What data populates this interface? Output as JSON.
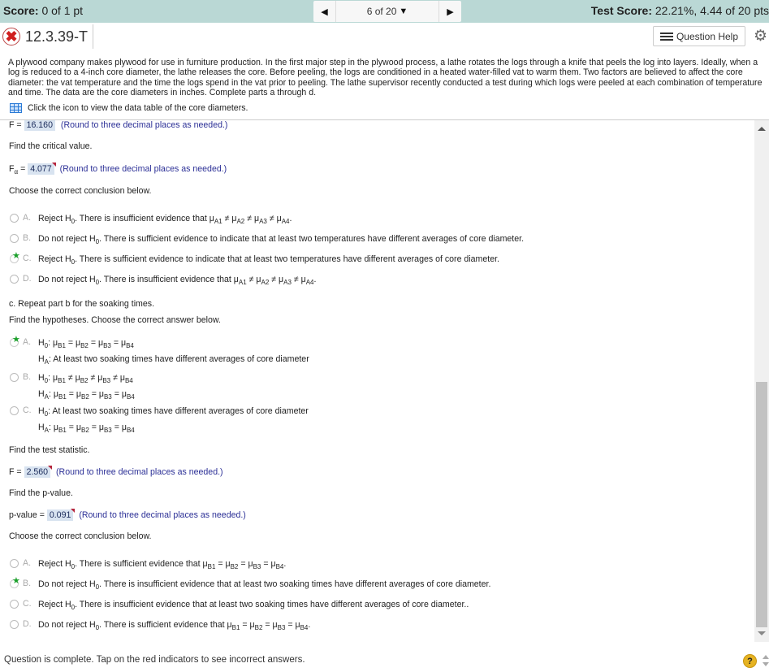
{
  "topbar": {
    "score_label": "Score:",
    "score_value": "0 of 1 pt",
    "nav": {
      "prev_icon": "◀",
      "position": "6 of 20",
      "caret": "▼",
      "next_icon": "▶"
    },
    "test_score_label": "Test Score:",
    "test_score_value": "22.21%, 4.44 of 20 pts"
  },
  "question_header": {
    "status_icon": "✖",
    "question_id": "12.3.39-T",
    "help_button": "Question Help",
    "settings_icon": "⚙"
  },
  "problem": {
    "text": "A plywood company makes plywood for use in furniture production. In the first major step in the plywood process, a lathe rotates the logs through a knife that peels the log into layers. Ideally, when a log is reduced to a 4-inch core diameter, the lathe releases the core. Before peeling, the logs are conditioned in a heated water-filled vat to warm them. Two factors are believed to affect the core diameter: the vat temperature and the time the logs spend in the vat prior to peeling. The lathe supervisor recently conducted a test during which logs were peeled at each combination of temperature and time. The data are the core diameters in inches. Complete parts a through d.",
    "data_link": "Click the icon to view the data table of the core diameters."
  },
  "content": {
    "f_stat_b": {
      "label": "F =",
      "value": "16.160",
      "hint": "(Round to three decimal places as needed.)"
    },
    "critical_prompt": "Find the critical value.",
    "critical": {
      "label_main": "F",
      "label_sub": "α",
      "label_eq": "=",
      "value": "4.077",
      "hint": "(Round to three decimal places as needed.)"
    },
    "conclusion_prompt_b": "Choose the correct conclusion below.",
    "options_b": [
      {
        "letter": "A.",
        "correct": false,
        "html": "Reject H<sub>0</sub>. There is insufficient evidence that μ<sub>A1</sub> ≠ μ<sub>A2</sub> ≠ μ<sub>A3</sub> ≠ μ<sub>A4</sub>."
      },
      {
        "letter": "B.",
        "correct": false,
        "html": "Do not reject H<sub>0</sub>. There is sufficient evidence to indicate that at least two temperatures have different averages of core diameter."
      },
      {
        "letter": "C.",
        "correct": true,
        "html": "Reject H<sub>0</sub>. There is sufficient evidence to indicate that at least two temperatures have different averages of core diameter."
      },
      {
        "letter": "D.",
        "correct": false,
        "html": "Do not reject H<sub>0</sub>. There is insufficient evidence that μ<sub>A1</sub> ≠ μ<sub>A2</sub> ≠ μ<sub>A3</sub> ≠ μ<sub>A4</sub>."
      }
    ],
    "part_c_title": "c. Repeat part b for the soaking times.",
    "hyp_prompt": "Find the hypotheses. Choose the correct answer below.",
    "options_hyp": [
      {
        "letter": "A.",
        "correct": true,
        "h0": "H<sub>0</sub>: μ<sub>B1</sub> = μ<sub>B2</sub> = μ<sub>B3</sub> = μ<sub>B4</sub>",
        "ha": "H<sub>A</sub>: At least two soaking times have different averages of core diameter"
      },
      {
        "letter": "B.",
        "correct": false,
        "h0": "H<sub>0</sub>: μ<sub>B1</sub> ≠ μ<sub>B2</sub> ≠ μ<sub>B3</sub> ≠ μ<sub>B4</sub>",
        "ha": "H<sub>A</sub>: μ<sub>B1</sub> = μ<sub>B2</sub> = μ<sub>B3</sub> = μ<sub>B4</sub>"
      },
      {
        "letter": "C.",
        "correct": false,
        "h0": "H<sub>0</sub>: At least two soaking times have different averages of core diameter",
        "ha": "H<sub>A</sub>: μ<sub>B1</sub> = μ<sub>B2</sub> = μ<sub>B3</sub> = μ<sub>B4</sub>"
      }
    ],
    "test_stat_prompt": "Find the test statistic.",
    "f_stat_c": {
      "label": "F =",
      "value": "2.560",
      "hint": "(Round to three decimal places as needed.)"
    },
    "pvalue_prompt": "Find the p-value.",
    "pvalue": {
      "label": "p-value =",
      "value": "0.091",
      "hint": "(Round to three decimal places as needed.)"
    },
    "conclusion_prompt_c": "Choose the correct conclusion below.",
    "options_c": [
      {
        "letter": "A.",
        "correct": false,
        "html": "Reject H<sub>0</sub>. There is sufficient evidence that μ<sub>B1</sub> = μ<sub>B2</sub> = μ<sub>B3</sub> = μ<sub>B4</sub>."
      },
      {
        "letter": "B.",
        "correct": true,
        "html": "Do not reject H<sub>0</sub>. There is insufficient evidence that at least two soaking times have different averages of core diameter."
      },
      {
        "letter": "C.",
        "correct": false,
        "html": "Reject H<sub>0</sub>. There is insufficient evidence that at least two soaking times have different averages of core diameter.."
      },
      {
        "letter": "D.",
        "correct": false,
        "html": "Do not reject H<sub>0</sub>. There is sufficient evidence that μ<sub>B1</sub> = μ<sub>B2</sub> = μ<sub>B3</sub> = μ<sub>B4</sub>."
      }
    ]
  },
  "footer": {
    "status": "Question is complete. Tap on the red indicators to see incorrect answers.",
    "help_icon": "?"
  }
}
